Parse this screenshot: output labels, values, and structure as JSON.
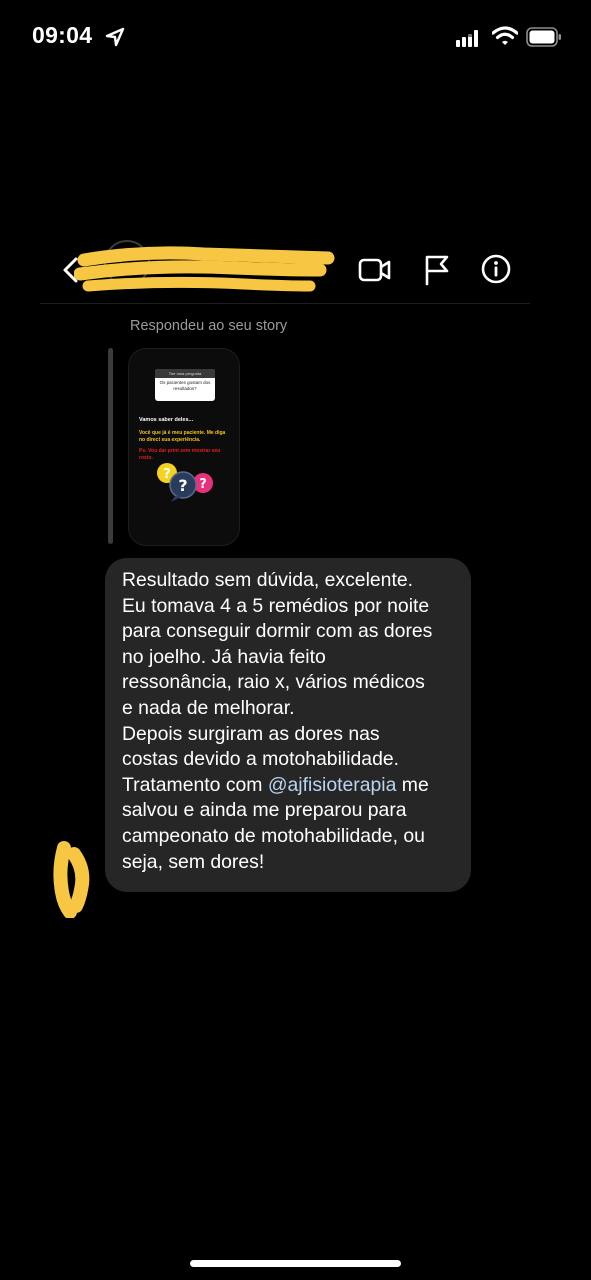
{
  "status_bar": {
    "time": "09:04",
    "icons": [
      "location-arrow-icon",
      "cellular-signal-icon",
      "wifi-icon",
      "battery-icon"
    ]
  },
  "header": {
    "username": "",
    "icons": [
      "back-chevron-icon",
      "video-call-icon",
      "flag-icon",
      "info-icon"
    ]
  },
  "conversation": {
    "reply_label": "Respondeu ao seu story",
    "story_preview": {
      "question_header": "Tire uma pergunta",
      "question": "Os pacientes gostam dos resultados?",
      "line1": "Vamos saber deles...",
      "line2": "Você que já é meu paciente.  Me diga no direct sua experiência.",
      "line3": "Ps: Vou dar print sem mostrar seu rosto."
    },
    "message": {
      "line1": "Resultado sem dúvida, excelente.",
      "line2": "Eu tomava 4 a 5 remédios por noite",
      "line3": "para conseguir dormir com as dores",
      "line4": "no joelho. Já havia feito",
      "line5": "ressonância, raio x, vários médicos",
      "line6": "e nada de melhorar.",
      "line7": "Depois surgiram as dores nas",
      "line8": "costas devido a motohabilidade.",
      "line9_pre": "Tratamento com ",
      "line9_mention": "@ajfisioterapia",
      "line9_post": " me",
      "line10": "salvou e ainda me preparou para",
      "line11": "campeonato de motohabilidade, ou",
      "line12": "seja, sem dores!"
    }
  },
  "colors": {
    "background": "#000000",
    "bubble": "#262626",
    "redaction": "#f7c744",
    "mention": "#b8d4f0",
    "muted_text": "#9a9a9a"
  }
}
